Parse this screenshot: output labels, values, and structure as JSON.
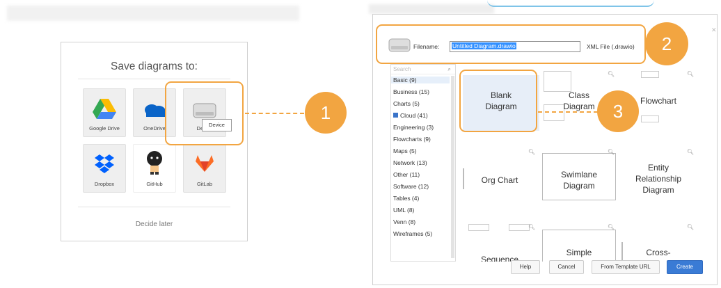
{
  "save_dialog": {
    "title": "Save diagrams to:",
    "options": [
      {
        "label": "Google Drive",
        "icon": "google-drive-icon"
      },
      {
        "label": "OneDrive",
        "icon": "onedrive-icon"
      },
      {
        "label": "Device",
        "icon": "device-drive-icon"
      },
      {
        "label": "Dropbox",
        "icon": "dropbox-icon"
      },
      {
        "label": "GitHub",
        "icon": "github-icon"
      },
      {
        "label": "GitLab",
        "icon": "gitlab-icon"
      }
    ],
    "tooltip": "Device",
    "decide_later": "Decide later"
  },
  "callouts": [
    "1",
    "2",
    "3"
  ],
  "template_dialog": {
    "filename_label": "Filename:",
    "filename_value": "Untitled Diagram.drawio",
    "format": "XML File (.drawio)",
    "search_placeholder": "Search",
    "categories": [
      "Basic (9)",
      "Business (15)",
      "Charts (5)",
      "Cloud (41)",
      "Engineering (3)",
      "Flowcharts (9)",
      "Maps (5)",
      "Network (13)",
      "Other (11)",
      "Software (12)",
      "Tables (4)",
      "UML (8)",
      "Venn (8)",
      "Wireframes (5)"
    ],
    "templates": [
      {
        "line1": "Blank",
        "line2": "Diagram"
      },
      {
        "line1": "Class",
        "line2": "Diagram"
      },
      {
        "line1": "Flowchart",
        "line2": ""
      },
      {
        "line1": "Org Chart",
        "line2": ""
      },
      {
        "line1": "Swimlane",
        "line2": "Diagram"
      },
      {
        "line1": "Entity",
        "line2": "Relationship",
        "line3": "Diagram"
      },
      {
        "line1": "Sequence",
        "line2": ""
      },
      {
        "line1": "Simple",
        "line2": ""
      },
      {
        "line1": "Cross-",
        "line2": ""
      }
    ],
    "buttons": {
      "help": "Help",
      "cancel": "Cancel",
      "from_template": "From Template URL",
      "create": "Create"
    }
  },
  "colors": {
    "accent": "#f2a541",
    "primary_button": "#3a7bd5",
    "selection": "#3390ff"
  }
}
